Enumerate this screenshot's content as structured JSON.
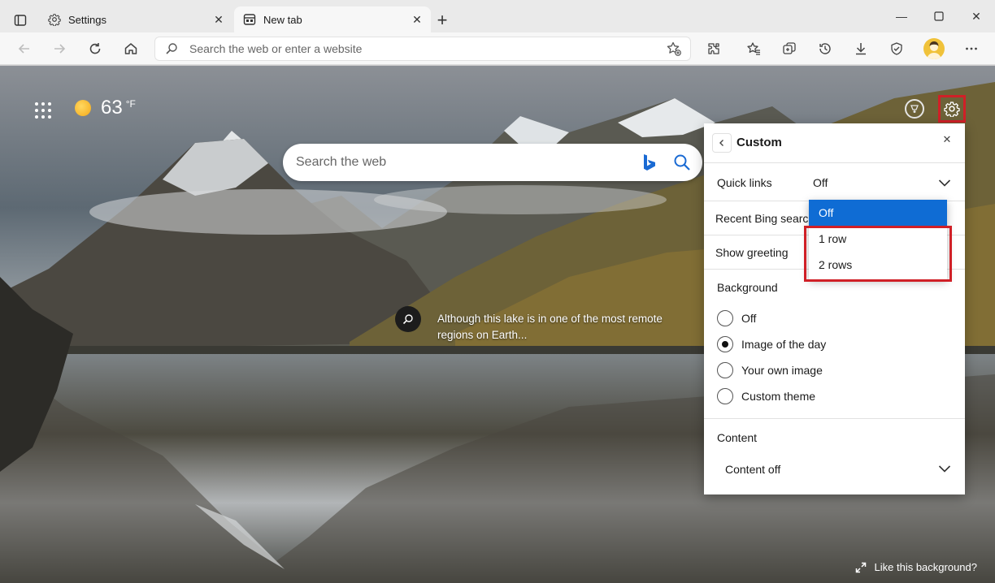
{
  "browser": {
    "tabs": [
      {
        "title": "Settings",
        "icon": "gear-icon"
      },
      {
        "title": "New tab",
        "icon": "newtab-icon"
      }
    ],
    "address_placeholder": "Search the web or enter a website"
  },
  "newtab": {
    "weather": {
      "temperature": "63",
      "unit": "°F"
    },
    "search_placeholder": "Search the web",
    "caption": "Although this lake is in one of the most remote regions on Earth...",
    "like_background": "Like this background?"
  },
  "panel": {
    "title": "Custom",
    "quick_links": {
      "label": "Quick links",
      "value": "Off"
    },
    "recent_bing_searches": {
      "label": "Recent Bing searches"
    },
    "show_greeting": {
      "label": "Show greeting"
    },
    "background": {
      "title": "Background",
      "options": [
        "Off",
        "Image of the day",
        "Your own image",
        "Custom theme"
      ],
      "selected": "Image of the day"
    },
    "content": {
      "title": "Content",
      "value": "Content off"
    }
  },
  "dropdown": {
    "options": [
      "Off",
      "1 row",
      "2 rows"
    ],
    "selected": "Off"
  },
  "colors": {
    "accent": "#0f6cd4",
    "highlight": "#d02027"
  }
}
